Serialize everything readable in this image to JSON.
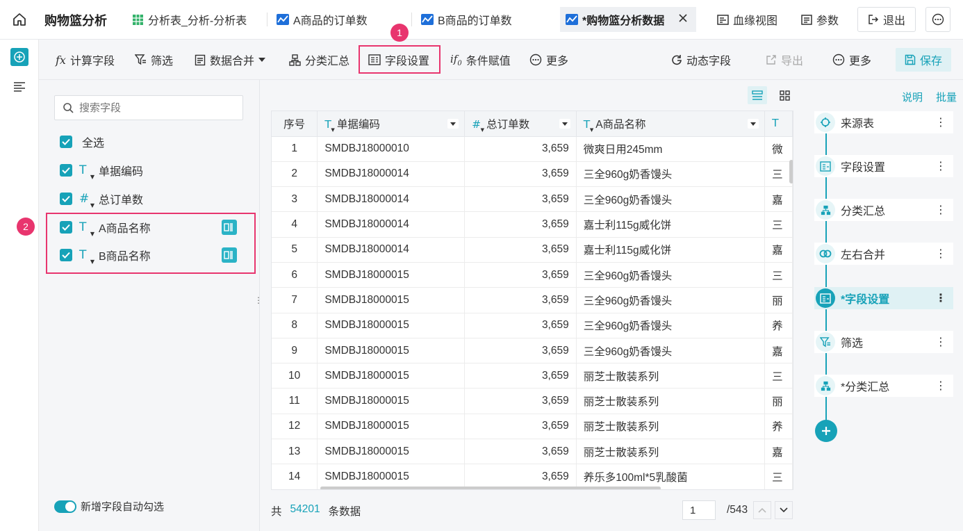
{
  "app": {
    "title": "购物篮分析"
  },
  "tabs": [
    {
      "label": "分析表_分析-分析表"
    },
    {
      "label": "A商品的订单数"
    },
    {
      "label": "B商品的订单数"
    },
    {
      "label": "*购物篮分析数据"
    }
  ],
  "top_actions": {
    "lineage": "血缘视图",
    "params": "参数",
    "logout": "退出"
  },
  "toolbar": {
    "calc_field": "计算字段",
    "filter": "筛选",
    "merge": "数据合并",
    "group": "分类汇总",
    "field_settings": "字段设置",
    "conditional": "条件赋值",
    "more": "更多",
    "dynamic_field": "动态字段",
    "export": "导出",
    "more2": "更多",
    "save": "保存"
  },
  "field_panel": {
    "search_placeholder": "搜索字段",
    "select_all": "全选",
    "fields": [
      {
        "name": "单据编码",
        "type": "text"
      },
      {
        "name": "总订单数",
        "type": "number"
      },
      {
        "name": "A商品名称",
        "type": "text"
      },
      {
        "name": "B商品名称",
        "type": "text"
      }
    ],
    "auto_check_label": "新增字段自动勾选"
  },
  "table": {
    "columns": [
      "序号",
      "单据编码",
      "总订单数",
      "A商品名称"
    ],
    "rows": [
      [
        "1",
        "SMDBJ18000010",
        "3,659",
        "微爽日用245mm",
        "微"
      ],
      [
        "2",
        "SMDBJ18000014",
        "3,659",
        "三全960g奶香馒头",
        "三"
      ],
      [
        "3",
        "SMDBJ18000014",
        "3,659",
        "三全960g奶香馒头",
        "嘉"
      ],
      [
        "4",
        "SMDBJ18000014",
        "3,659",
        "嘉士利115g威化饼",
        "三"
      ],
      [
        "5",
        "SMDBJ18000014",
        "3,659",
        "嘉士利115g威化饼",
        "嘉"
      ],
      [
        "6",
        "SMDBJ18000015",
        "3,659",
        "三全960g奶香馒头",
        "三"
      ],
      [
        "7",
        "SMDBJ18000015",
        "3,659",
        "三全960g奶香馒头",
        "丽"
      ],
      [
        "8",
        "SMDBJ18000015",
        "3,659",
        "三全960g奶香馒头",
        "养"
      ],
      [
        "9",
        "SMDBJ18000015",
        "3,659",
        "三全960g奶香馒头",
        "嘉"
      ],
      [
        "10",
        "SMDBJ18000015",
        "3,659",
        "丽芝士散装系列",
        "三"
      ],
      [
        "11",
        "SMDBJ18000015",
        "3,659",
        "丽芝士散装系列",
        "丽"
      ],
      [
        "12",
        "SMDBJ18000015",
        "3,659",
        "丽芝士散装系列",
        "养"
      ],
      [
        "13",
        "SMDBJ18000015",
        "3,659",
        "丽芝士散装系列",
        "嘉"
      ],
      [
        "14",
        "SMDBJ18000015",
        "3,659",
        "养乐多100ml*5乳酸菌",
        "三"
      ]
    ]
  },
  "footer": {
    "total_prefix": "共",
    "total_count": "54201",
    "total_suffix": "条数据",
    "page": "1",
    "page_total": "/543"
  },
  "flow": {
    "explain": "说明",
    "batch": "批量",
    "nodes": [
      {
        "label": "来源表",
        "icon": "source-icon"
      },
      {
        "label": "字段设置",
        "icon": "field-settings-icon"
      },
      {
        "label": "分类汇总",
        "icon": "group-icon"
      },
      {
        "label": "左右合并",
        "icon": "merge-icon"
      },
      {
        "label": "*字段设置",
        "icon": "field-settings-icon",
        "active": true
      },
      {
        "label": "筛选",
        "icon": "filter-icon"
      },
      {
        "label": "*分类汇总",
        "icon": "group-icon"
      }
    ]
  },
  "annotations": {
    "badge1": "1",
    "badge2": "2"
  },
  "colors": {
    "accent": "#17a2b8",
    "highlight": "#e8356e"
  }
}
